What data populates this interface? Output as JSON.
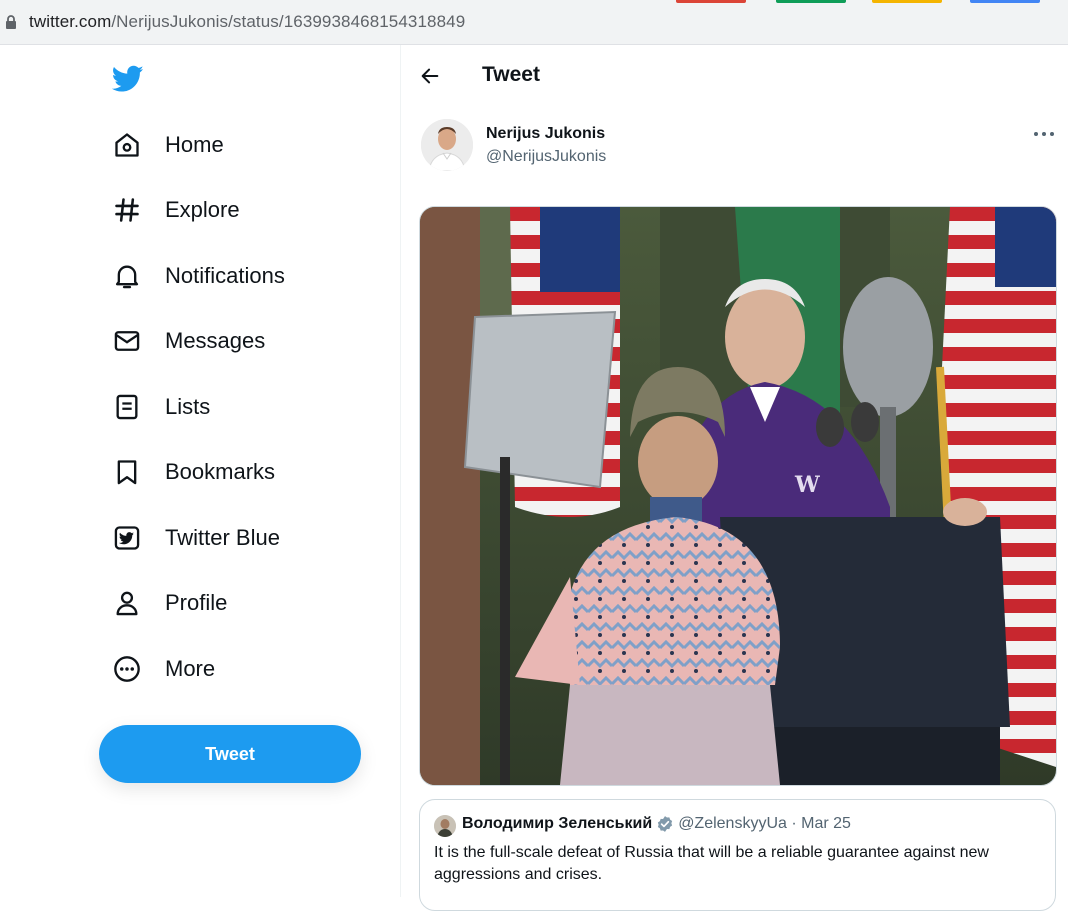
{
  "browser": {
    "url_host": "twitter.com",
    "url_path": "/NerijusJukonis/status/1639938468154318849",
    "tab_colors": [
      "#db4437",
      "#0f9d58",
      "#f4b400",
      "#4285f4"
    ]
  },
  "nav": {
    "items": [
      {
        "label": "Home",
        "icon": "home-icon"
      },
      {
        "label": "Explore",
        "icon": "hashtag-icon"
      },
      {
        "label": "Notifications",
        "icon": "bell-icon"
      },
      {
        "label": "Messages",
        "icon": "envelope-icon"
      },
      {
        "label": "Lists",
        "icon": "list-icon"
      },
      {
        "label": "Bookmarks",
        "icon": "bookmark-icon"
      },
      {
        "label": "Twitter Blue",
        "icon": "twitter-blue-icon"
      },
      {
        "label": "Profile",
        "icon": "person-icon"
      },
      {
        "label": "More",
        "icon": "more-circle-icon"
      }
    ],
    "tweet_button": "Tweet",
    "accent": "#1d9bf0"
  },
  "main": {
    "header_title": "Tweet",
    "author": {
      "name": "Nerijus Jukonis",
      "handle": "@NerijusJukonis"
    },
    "quote": {
      "name": "Володимир Зеленський",
      "handle": "@ZelenskyyUa",
      "separator": "·",
      "date": "Mar 25",
      "text": "It is the full-scale defeat of Russia that will be a reliable guarantee against new aggressions and crises."
    }
  }
}
